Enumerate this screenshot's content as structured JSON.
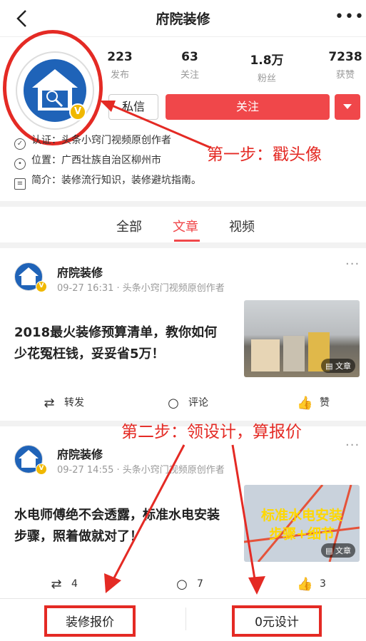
{
  "header": {
    "title": "府院装修"
  },
  "profile": {
    "stats": [
      {
        "value": "223",
        "label": "发布"
      },
      {
        "value": "63",
        "label": "关注"
      },
      {
        "value": "1.8万",
        "label": "粉丝"
      },
      {
        "value": "7238",
        "label": "获赞"
      }
    ],
    "message_label": "私信",
    "follow_label": "关注",
    "verified_badge": "V",
    "info": {
      "cert": "认证：头条小窍门视频原创作者",
      "location": "位置：广西壮族自治区柳州市",
      "bio": "简介：装修流行知识，装修避坑指南。"
    }
  },
  "annotations": {
    "step1": "第一步：戳头像",
    "step2": "第二步：领设计，算报价"
  },
  "tabs": [
    "全部",
    "文章",
    "视频"
  ],
  "posts": [
    {
      "author": "府院装修",
      "meta": "09-27 16:31 · 头条小窍门视频原创作者",
      "title": "2018最火装修预算清单，教你如何少花冤枉钱，妥妥省5万！",
      "tag": "文章",
      "actions": {
        "repost": "转发",
        "comment": "评论",
        "like": "赞"
      }
    },
    {
      "author": "府院装修",
      "meta": "09-27 14:55 · 头条小窍门视频原创作者",
      "title": "水电师傅绝不会透露，标准水电安装步骤，照着做就对了！",
      "thumb_text_line1": "标准水电安装",
      "thumb_text_line2": "步骤+细节",
      "tag": "文章",
      "actions": {
        "repost": "4",
        "comment": "7",
        "like": "3"
      }
    }
  ],
  "bottom": {
    "quote_label": "装修报价",
    "design_label": "0元设计"
  },
  "colors": {
    "accent": "#f0474a",
    "annotation": "#e42a24",
    "brand_blue": "#1f63b8",
    "verified": "#f0b800"
  }
}
